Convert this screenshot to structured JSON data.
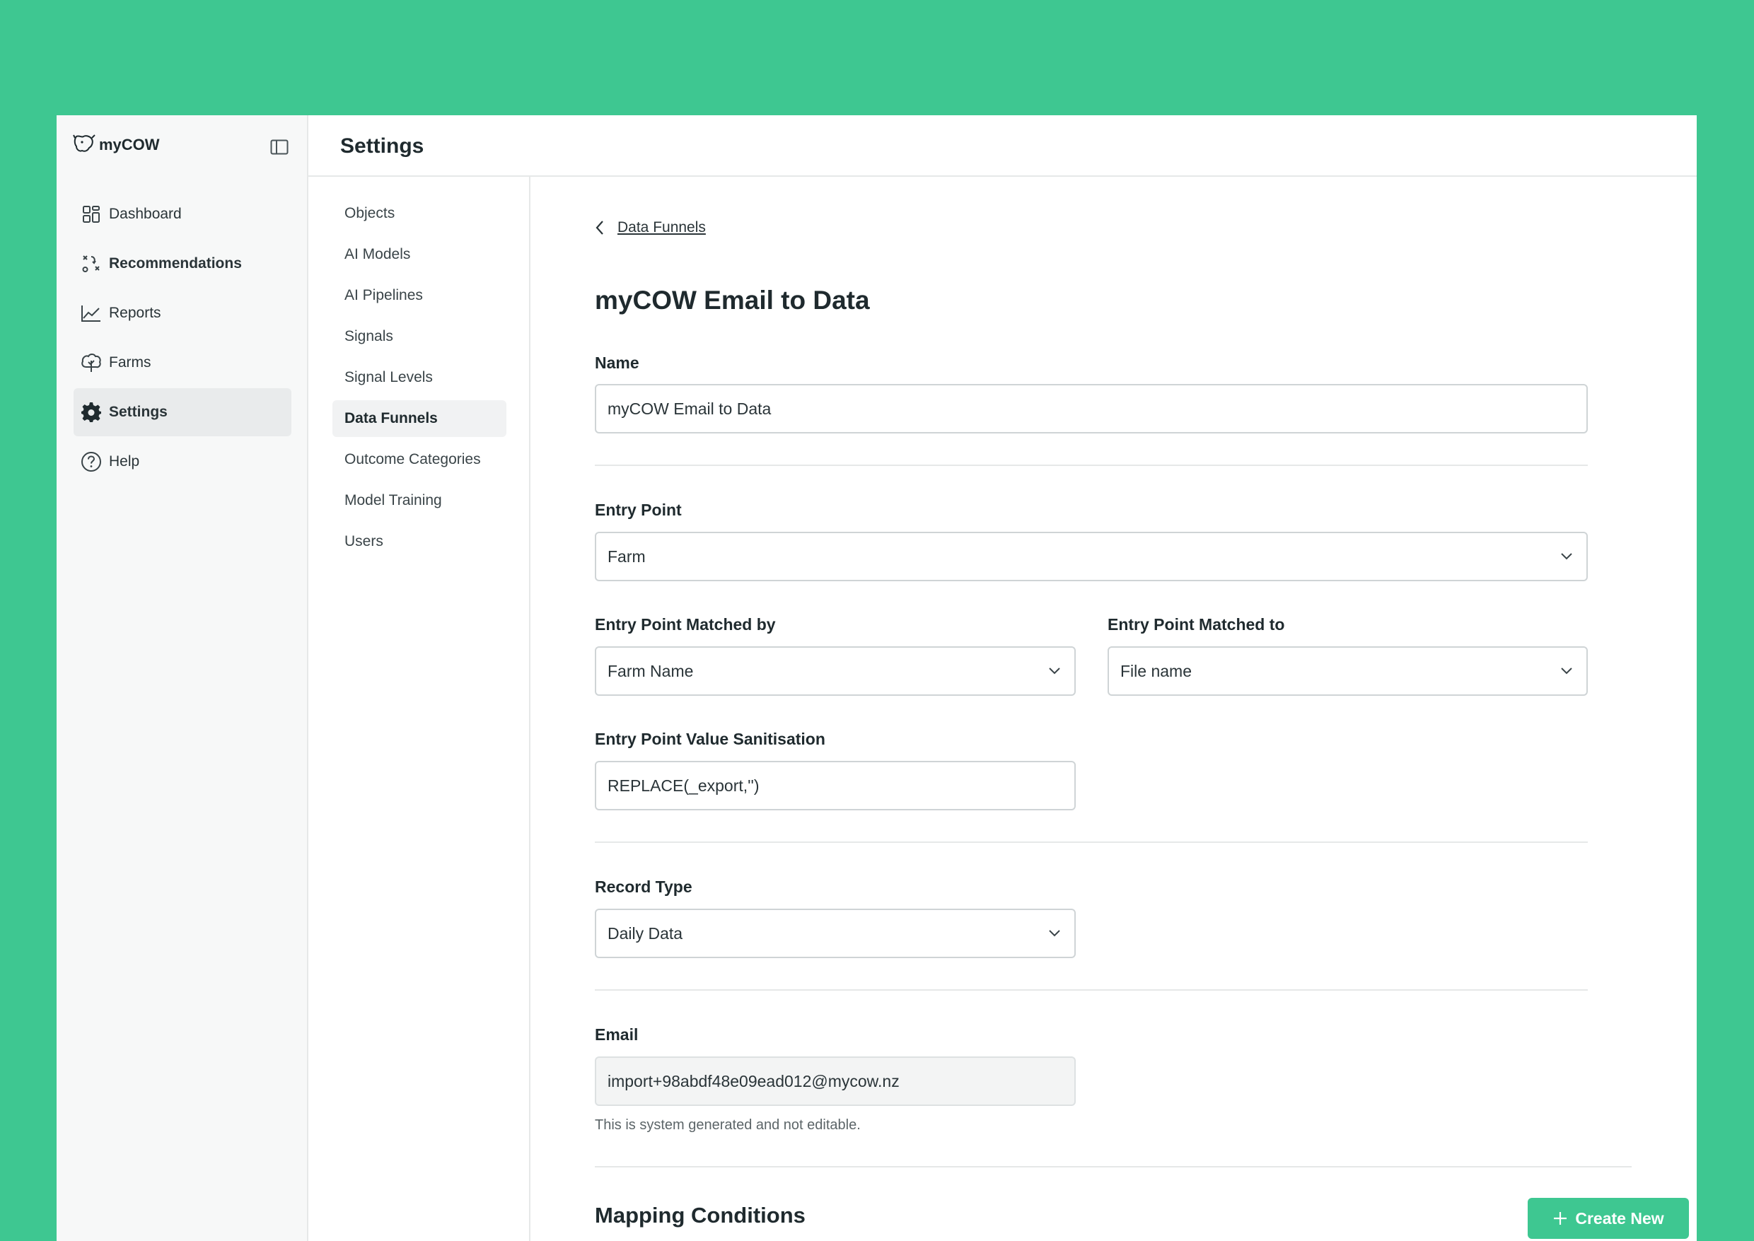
{
  "app": {
    "logo_text": "myCOW"
  },
  "sidebar": {
    "items": [
      {
        "label": "Dashboard",
        "icon": "grid-icon"
      },
      {
        "label": "Recommendations",
        "icon": "tactics-icon"
      },
      {
        "label": "Reports",
        "icon": "line-chart-icon"
      },
      {
        "label": "Farms",
        "icon": "tree-icon"
      },
      {
        "label": "Settings",
        "icon": "gear-icon"
      },
      {
        "label": "Help",
        "icon": "help-circle-icon"
      }
    ]
  },
  "header": {
    "title": "Settings"
  },
  "subnav": {
    "items": [
      {
        "label": "Objects"
      },
      {
        "label": "AI Models"
      },
      {
        "label": "AI Pipelines"
      },
      {
        "label": "Signals"
      },
      {
        "label": "Signal Levels"
      },
      {
        "label": "Data Funnels"
      },
      {
        "label": "Outcome Categories"
      },
      {
        "label": "Model Training"
      },
      {
        "label": "Users"
      }
    ],
    "active": "Data Funnels"
  },
  "main": {
    "breadcrumb": "Data Funnels",
    "title": "myCOW Email to Data",
    "name": {
      "label": "Name",
      "value": "myCOW Email to Data"
    },
    "entry_point": {
      "label": "Entry Point",
      "value": "Farm"
    },
    "matched_by": {
      "label": "Entry Point Matched by",
      "value": "Farm Name"
    },
    "matched_to": {
      "label": "Entry Point Matched to",
      "value": "File name"
    },
    "sanitisation": {
      "label": "Entry Point Value Sanitisation",
      "value": "REPLACE(_export,'')"
    },
    "record_type": {
      "label": "Record Type",
      "value": "Daily Data"
    },
    "email": {
      "label": "Email",
      "value": "import+98abdf48e09ead012@mycow.nz",
      "helper": "This is system generated and not editable."
    },
    "mapping": {
      "title": "Mapping Conditions",
      "create_label": "Create New"
    }
  },
  "colors": {
    "background": "#3ec791",
    "accent": "#3ec791",
    "sidebar_bg": "#f7f8f8"
  }
}
